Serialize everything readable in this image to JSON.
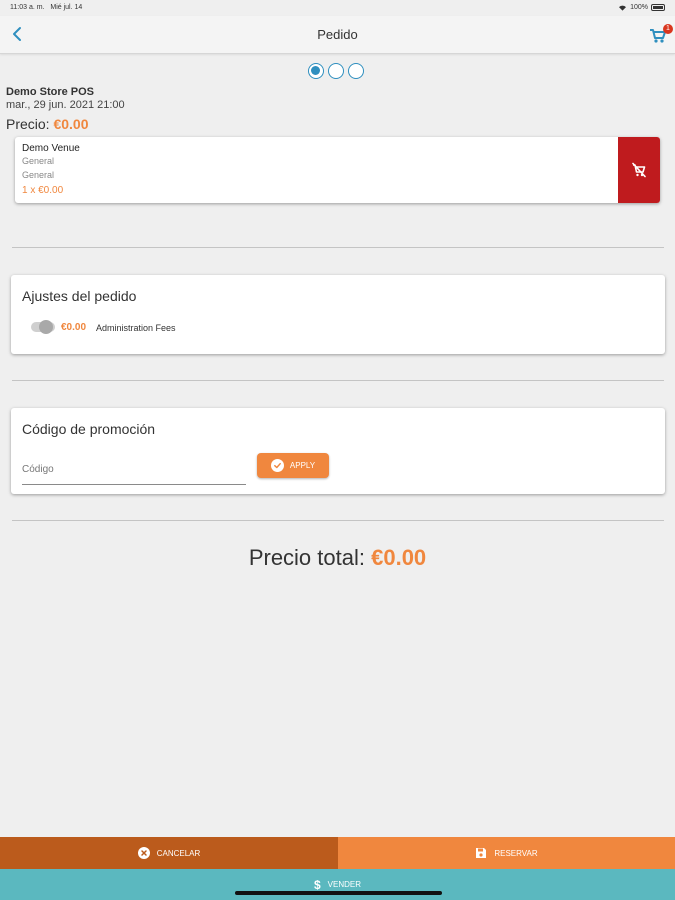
{
  "status_bar": {
    "time": "11:03 a. m.",
    "date": "Mié jul. 14",
    "battery": "100%"
  },
  "navbar": {
    "title": "Pedido",
    "cart_count": "1"
  },
  "steps": {
    "current": 1,
    "total": 3
  },
  "order": {
    "store_name": "Demo Store POS",
    "date": "mar., 29 jun. 2021 21:00",
    "price_label": "Precio:",
    "price_value": "€0.00"
  },
  "item": {
    "venue": "Demo Venue",
    "line1": "General",
    "line2": "General",
    "quantity": "1 x €0.00"
  },
  "settings": {
    "title": "Ajustes del pedido",
    "fee_price": "€0.00",
    "fee_label": "Administration Fees"
  },
  "promo": {
    "title": "Código de promoción",
    "placeholder": "Código",
    "value": "",
    "apply_label": "APPLY"
  },
  "total": {
    "label": "Precio total:",
    "value": "€0.00"
  },
  "actions": {
    "cancel_label": "CANCELAR",
    "reserve_label": "RESERVAR",
    "sell_label": "VENDER"
  },
  "colors": {
    "accent_orange": "#f0873e",
    "dark_orange": "#bb5b1c",
    "teal": "#5bb8bf",
    "remove_red": "#bf1b1e",
    "step_blue": "#2f8fbf"
  }
}
